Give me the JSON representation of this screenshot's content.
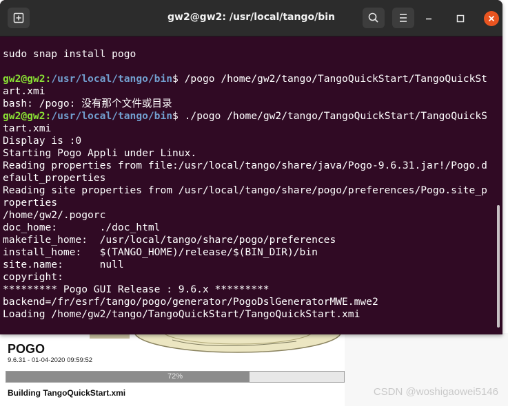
{
  "splash": {
    "title": "POGO",
    "version": "9.6.31 - 01-04-2020 09:59:52",
    "progress_percent": 72,
    "progress_label": "72%",
    "status": "Building  TangoQuickStart.xmi",
    "watermark": "CSDN @woshigaowei5146"
  },
  "terminal": {
    "title": "gw2@gw2: /usr/local/tango/bin",
    "lines": [
      {
        "text": "sudo snap install pogo"
      },
      {
        "text": ""
      },
      {
        "user": "gw2@gw2",
        "path": "/usr/local/tango/bin",
        "text": "$ /pogo /home/gw2/tango/TangoQuickStart/TangoQuickSt"
      },
      {
        "text": "art.xmi"
      },
      {
        "text": "bash: /pogo: 没有那个文件或目录"
      },
      {
        "user": "gw2@gw2",
        "path": "/usr/local/tango/bin",
        "text": "$ ./pogo /home/gw2/tango/TangoQuickStart/TangoQuickS"
      },
      {
        "text": "tart.xmi"
      },
      {
        "text": "Display is :0"
      },
      {
        "text": "Starting Pogo Appli under Linux."
      },
      {
        "text": "Reading properties from file:/usr/local/tango/share/java/Pogo-9.6.31.jar!/Pogo.d"
      },
      {
        "text": "efault_properties"
      },
      {
        "text": "Reading site properties from /usr/local/tango/share/pogo/preferences/Pogo.site_p"
      },
      {
        "text": "roperties"
      },
      {
        "text": "/home/gw2/.pogorc"
      },
      {
        "text": "doc_home:       ./doc_html"
      },
      {
        "text": "makefile_home:  /usr/local/tango/share/pogo/preferences"
      },
      {
        "text": "install_home:   $(TANGO_HOME)/release/$(BIN_DIR)/bin"
      },
      {
        "text": "site.name:      null"
      },
      {
        "text": "copyright:"
      },
      {
        "text": "********* Pogo GUI Release : 9.6.x *********"
      },
      {
        "text": "backend=/fr/esrf/tango/pogo/generator/PogoDslGeneratorMWE.mwe2"
      },
      {
        "text": "Loading /home/gw2/tango/TangoQuickStart/TangoQuickStart.xmi"
      }
    ]
  },
  "icons": {
    "new_tab": "new-tab-icon",
    "search": "search-icon",
    "menu": "hamburger-menu-icon",
    "minimize": "minimize-icon",
    "maximize": "maximize-icon",
    "close": "close-icon"
  },
  "colors": {
    "terminal_bg": "#300a24",
    "titlebar_bg": "#2c2c2c",
    "prompt_user": "#8ae234",
    "prompt_path": "#729fcf",
    "close_button": "#e95420",
    "progress_fill": "#8c8c8c"
  }
}
